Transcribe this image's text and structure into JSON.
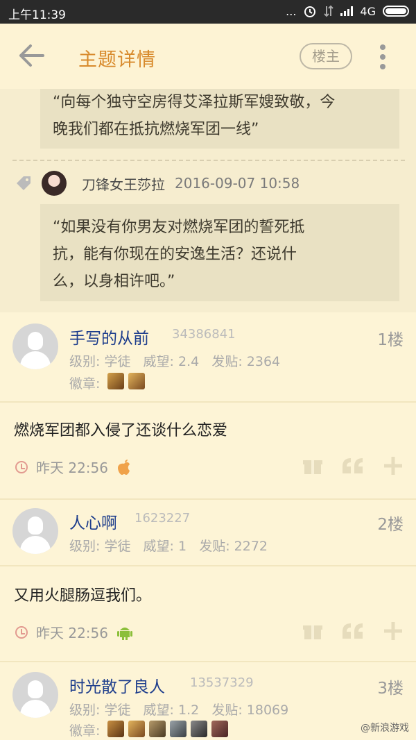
{
  "statusbar": {
    "time": "上午11:39",
    "dots": "...",
    "network": "4G"
  },
  "header": {
    "title": "主题详情",
    "owner_button": "楼主"
  },
  "quote": {
    "top_text_line1": "“向每个独守空房得艾泽拉斯军嫂致敬，今",
    "top_text_line2": "晚我们都在抵抗燃烧军团一线”",
    "reply_name": "刀锋女王莎拉",
    "reply_time": "2016-09-07 10:58",
    "reply_text_line1": "“如果没有你男友对燃烧军团的誓死抵",
    "reply_text_line2": "抗，能有你现在的安逸生活？还说什",
    "reply_text_line3": "么，以身相许吧。”"
  },
  "posts": [
    {
      "username": "手写的从前",
      "uid": "34386841",
      "floor": "1楼",
      "stats": "级别: 学徒   威望: 2.4   发贴: 2364",
      "badges_label": "徽章:",
      "badge_colors": [
        "#8a5a2a",
        "#9b6b2c"
      ],
      "content": "燃烧军团都入侵了还谈什么恋爱",
      "time": "昨天 22:56",
      "device": "apple"
    },
    {
      "username": "人心啊",
      "uid": "1623227",
      "floor": "2楼",
      "stats": "级别: 学徒   威望: 1   发贴: 2272",
      "content": "又用火腿肠逗我们。",
      "time": "昨天 22:56",
      "device": "android"
    },
    {
      "username": "时光散了良人",
      "uid": "13537329",
      "floor": "3楼",
      "stats": "级别: 学徒   威望: 1.2   发贴: 18069",
      "badges_label": "徽章:",
      "badge_colors": [
        "#7a4a22",
        "#9b6b2c",
        "#6a5a3a",
        "#555b5e",
        "#4a4a4a",
        "#6b3a3a"
      ]
    }
  ],
  "watermark": "@新浪游戏",
  "colors": {
    "accent": "#d88a2c",
    "background": "#fdf5dc",
    "username": "#1d3d8c"
  }
}
